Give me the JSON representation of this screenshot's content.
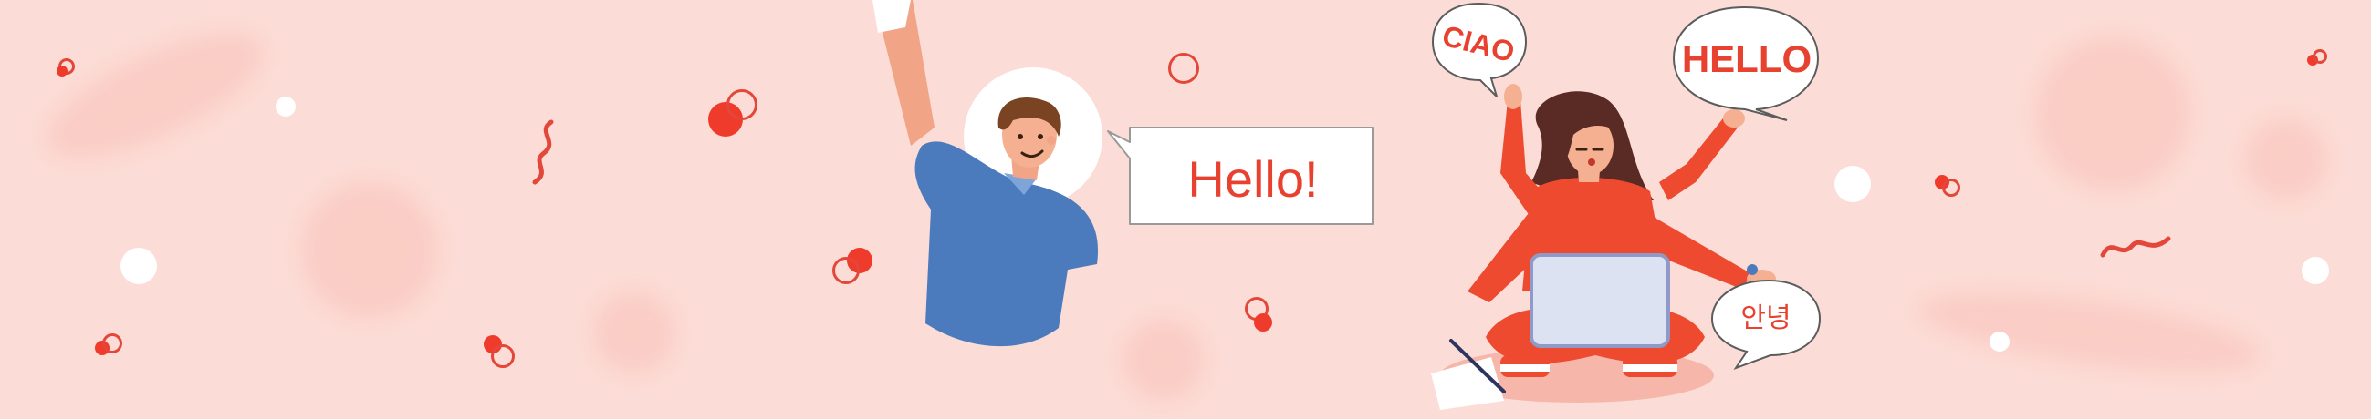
{
  "banner": {
    "greetings": {
      "hello_exclaim": "Hello!",
      "ciao": "CIAO",
      "hello_caps": "HELLO",
      "korean": "안녕"
    },
    "colors": {
      "background": "#fcdcd6",
      "accent_red": "#e8412f",
      "shirt_blue": "#4c7bbd",
      "sweater_red": "#ee4a30"
    }
  }
}
